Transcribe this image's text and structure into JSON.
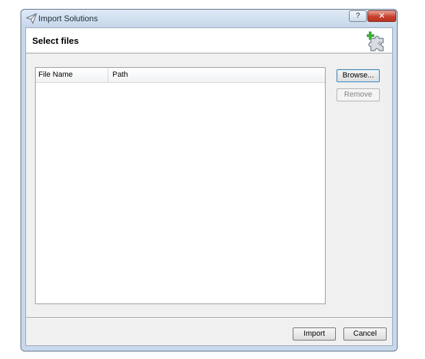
{
  "window": {
    "title": "Import Solutions",
    "help_label": "?",
    "close_label": "✕"
  },
  "header": {
    "title": "Select files"
  },
  "file_list": {
    "columns": [
      "File Name",
      "Path"
    ],
    "rows": []
  },
  "buttons": {
    "browse": "Browse...",
    "remove": "Remove",
    "import": "Import",
    "cancel": "Cancel"
  },
  "icons": {
    "title": "paper-plane-icon",
    "header": "puzzle-add-icon",
    "help": "help-icon",
    "close": "close-icon"
  },
  "colors": {
    "window_frame": "#c9d9ec",
    "close_button": "#c8412d",
    "dialog_body": "#f0f0f0"
  }
}
